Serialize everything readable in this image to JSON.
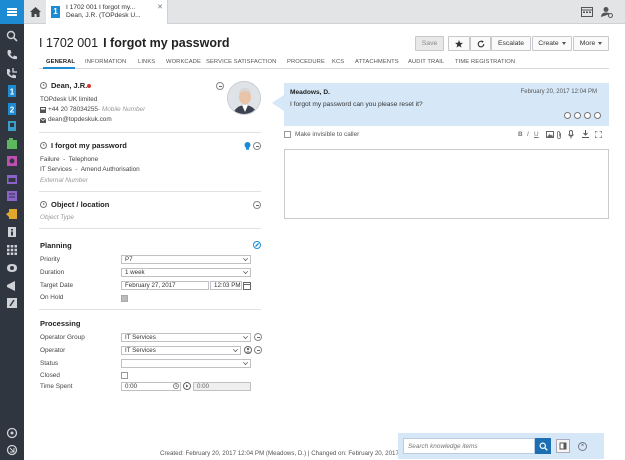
{
  "tab": {
    "line1": "I 1702 001 I forgot my...",
    "line2": "Dean, J.R. (TOPdesk U...",
    "badge": "1"
  },
  "header": {
    "number": "I 1702 001",
    "subject": "I forgot my password"
  },
  "buttons": {
    "save": "Save",
    "escalate": "Escalate",
    "create": "Create",
    "more": "More"
  },
  "tabs": [
    "General",
    "Information",
    "Links",
    "Workcade",
    "Service satisfaction",
    "Procedure",
    "KCS",
    "Attachments",
    "Audit trail",
    "Time registration"
  ],
  "caller": {
    "name": "Dean, J.R.",
    "company": "TOPdesk UK limited",
    "phone": "+44 20 78034255",
    "mobile_placeholder": "Mobile Number",
    "email": "dean@topdeskuk.com"
  },
  "request": {
    "title": "I forgot my password",
    "category": "Failure",
    "subcategory": "Telephone",
    "operator_group_short": "IT Services",
    "service": "Amend Authorisation",
    "external_number_placeholder": "External Number"
  },
  "object": {
    "title": "Object / location",
    "object_type_placeholder": "Object Type"
  },
  "planning": {
    "title": "Planning",
    "priority_label": "Priority",
    "priority_value": "P7",
    "duration_label": "Duration",
    "duration_value": "1 week",
    "target_label": "Target Date",
    "target_date": "February 27, 2017",
    "target_time": "12:03 PM",
    "onhold_label": "On Hold"
  },
  "processing": {
    "title": "Processing",
    "op_group_label": "Operator Group",
    "op_group_value": "IT Services",
    "operator_label": "Operator",
    "operator_value": "IT Services",
    "status_label": "Status",
    "status_value": "",
    "closed_label": "Closed",
    "time_label": "Time Spent",
    "time_value": "0:00",
    "time_add_value": "0:00"
  },
  "note": {
    "author": "Meadows, D.",
    "timestamp": "February 20, 2017 12:04 PM",
    "message": "I forgot my password can you please reset it?"
  },
  "invisible_label": "Make invisible to caller",
  "footer": "Created: February 20, 2017 12:04 PM (Meadows, D.) | Changed on: February 20, 2017",
  "kb": {
    "placeholder": "Search knowledge items",
    "close": "×"
  },
  "colors": {
    "accent": "#1d8bd3",
    "rail": "#2f3640",
    "note": "#d6e8f8",
    "alert": "#d9342b"
  }
}
